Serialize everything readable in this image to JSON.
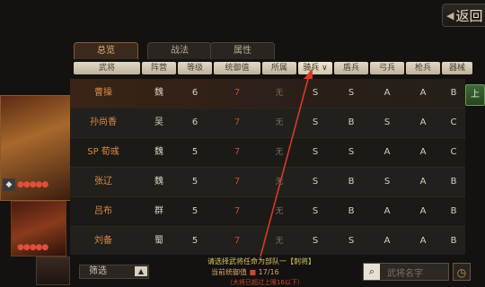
{
  "nav": {
    "back_label": "返回"
  },
  "tabs": [
    {
      "label": "总览",
      "active": true
    },
    {
      "label": "战法",
      "active": false
    },
    {
      "label": "属性",
      "active": false
    }
  ],
  "columns": [
    "武将",
    "阵营",
    "等级",
    "统御值",
    "所属",
    "骑兵 ∨",
    "盾兵",
    "弓兵",
    "枪兵",
    "器械"
  ],
  "sorted_column": "骑兵",
  "rows": [
    {
      "name": "曹操",
      "camp": "魏",
      "level": "6",
      "cost": "7",
      "team": "无",
      "cav": "S",
      "shield": "S",
      "bow": "A",
      "spear": "A",
      "siege": "B",
      "selected": true
    },
    {
      "name": "孙尚香",
      "camp": "吴",
      "level": "6",
      "cost": "7",
      "team": "无",
      "cav": "S",
      "shield": "B",
      "bow": "S",
      "spear": "A",
      "siege": "C"
    },
    {
      "name": "SP 荀彧",
      "camp": "魏",
      "level": "5",
      "cost": "7",
      "team": "无",
      "cav": "S",
      "shield": "S",
      "bow": "A",
      "spear": "A",
      "siege": "C"
    },
    {
      "name": "张辽",
      "camp": "魏",
      "level": "5",
      "cost": "7",
      "team": "无",
      "cav": "S",
      "shield": "B",
      "bow": "S",
      "spear": "A",
      "siege": "B"
    },
    {
      "name": "吕布",
      "camp": "群",
      "level": "5",
      "cost": "7",
      "team": "无",
      "cav": "S",
      "shield": "B",
      "bow": "A",
      "spear": "A",
      "siege": "B"
    },
    {
      "name": "刘备",
      "camp": "蜀",
      "level": "5",
      "cost": "7",
      "team": "无",
      "cav": "S",
      "shield": "S",
      "bow": "A",
      "spear": "A",
      "siege": "B"
    }
  ],
  "up_button": "上",
  "card_stars": "●●●●●",
  "bottom": {
    "filter_label": "筛选",
    "notice": "请选择武将任命为部队一【刺将】",
    "count_label": "当前统御值",
    "count_value": "17/16",
    "hint": "（大将已超过上限16以下）",
    "search_placeholder": "武将名字"
  },
  "colors": {
    "accent": "#d88a4a",
    "value_red": "#c94a3a",
    "notice_yellow": "#d6c860"
  }
}
